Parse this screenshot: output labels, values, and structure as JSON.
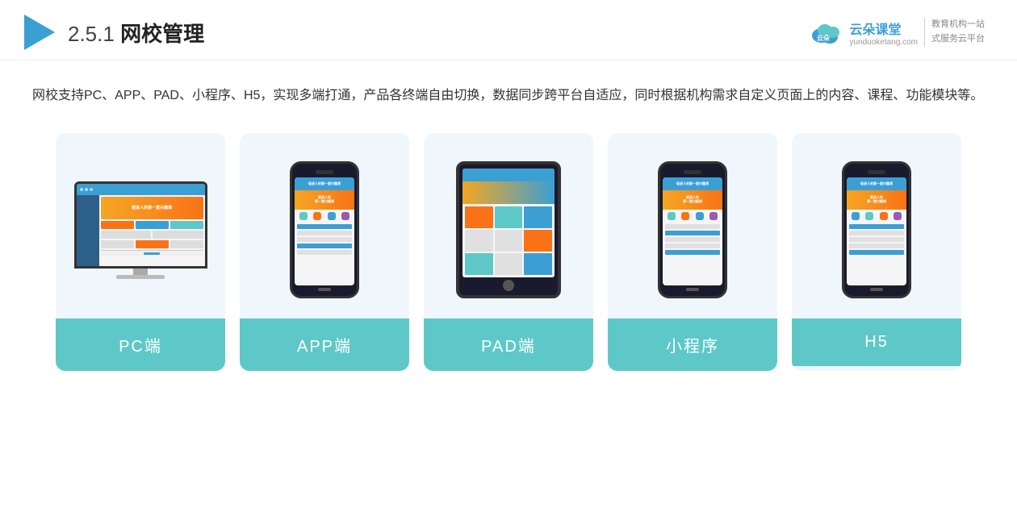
{
  "header": {
    "section_number": "2.5.1",
    "title": "网校管理",
    "logo_name": "云朵课堂",
    "logo_url": "yunduoketang.com",
    "logo_slogan_line1": "教育机构一站",
    "logo_slogan_line2": "式服务云平台"
  },
  "description": {
    "text": "网校支持PC、APP、PAD、小程序、H5，实现多端打通，产品各终端自由切换，数据同步跨平台自适应，同时根据机构需求自定义页面上的内容、课程、功能模块等。"
  },
  "cards": [
    {
      "id": "pc",
      "label": "PC端"
    },
    {
      "id": "app",
      "label": "APP端"
    },
    {
      "id": "pad",
      "label": "PAD端"
    },
    {
      "id": "miniprogram",
      "label": "小程序"
    },
    {
      "id": "h5",
      "label": "H5"
    }
  ]
}
